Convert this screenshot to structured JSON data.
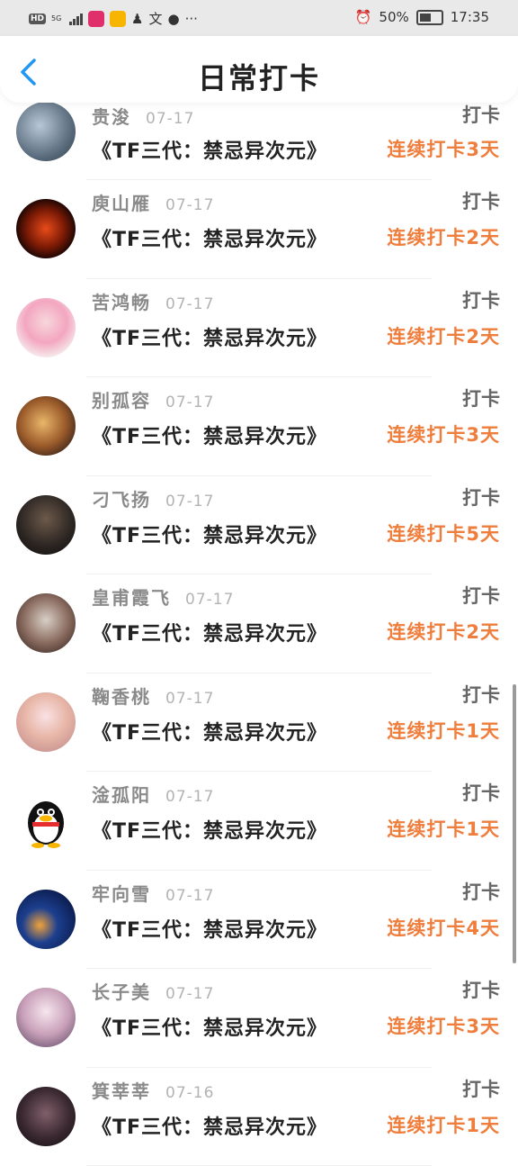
{
  "status_bar": {
    "network": "5G",
    "battery": "50%",
    "time": "17:35",
    "icons": [
      "hd-icon",
      "signal-icon",
      "app-icon",
      "weibo-icon",
      "qq-icon",
      "translate-icon",
      "dot-icon",
      "more-icon",
      "alarm-icon",
      "battery-icon"
    ]
  },
  "header": {
    "title": "日常打卡",
    "back_icon": "chevron-left-icon",
    "accent_color": "#2196f3"
  },
  "list": {
    "action_label": "打卡",
    "streak_color": "#ef7d3c",
    "items": [
      {
        "name": "贵浚",
        "date": "07-17",
        "book": "《TF三代：禁忌异次元》",
        "streak": "连续打卡3天"
      },
      {
        "name": "庾山雁",
        "date": "07-17",
        "book": "《TF三代：禁忌异次元》",
        "streak": "连续打卡2天"
      },
      {
        "name": "苦鸿畅",
        "date": "07-17",
        "book": "《TF三代：禁忌异次元》",
        "streak": "连续打卡2天"
      },
      {
        "name": "别孤容",
        "date": "07-17",
        "book": "《TF三代：禁忌异次元》",
        "streak": "连续打卡3天"
      },
      {
        "name": "刁飞扬",
        "date": "07-17",
        "book": "《TF三代：禁忌异次元》",
        "streak": "连续打卡5天"
      },
      {
        "name": "皇甫霞飞",
        "date": "07-17",
        "book": "《TF三代：禁忌异次元》",
        "streak": "连续打卡2天"
      },
      {
        "name": "鞠香桃",
        "date": "07-17",
        "book": "《TF三代：禁忌异次元》",
        "streak": "连续打卡1天"
      },
      {
        "name": "淦孤阳",
        "date": "07-17",
        "book": "《TF三代：禁忌异次元》",
        "streak": "连续打卡1天"
      },
      {
        "name": "牢向雪",
        "date": "07-17",
        "book": "《TF三代：禁忌异次元》",
        "streak": "连续打卡4天"
      },
      {
        "name": "长子美",
        "date": "07-17",
        "book": "《TF三代：禁忌异次元》",
        "streak": "连续打卡3天"
      },
      {
        "name": "箕莘莘",
        "date": "07-16",
        "book": "《TF三代：禁忌异次元》",
        "streak": "连续打卡1天"
      }
    ]
  }
}
